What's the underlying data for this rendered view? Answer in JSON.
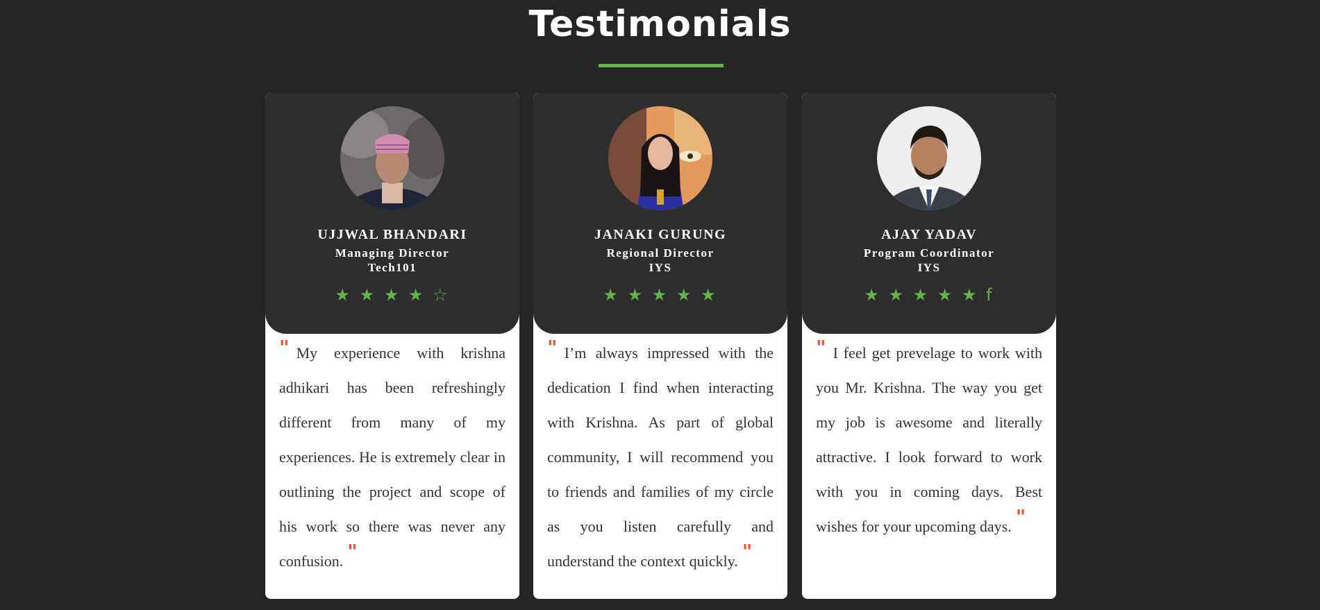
{
  "section": {
    "title": "Testimonials"
  },
  "colors": {
    "background": "#252525",
    "card_header": "#2d2d2d",
    "accent": "#62b348",
    "quote_mark": "#e8582c"
  },
  "testimonials": [
    {
      "name": "UJJWAL BHANDARI",
      "role": "Managing Director",
      "organization": "Tech101",
      "rating": 4,
      "stars": [
        "★",
        "★",
        "★",
        "★",
        "☆"
      ],
      "quote": "My experience with krishna adhikari has been refreshingly different from many of my experiences. He is extremely clear in outlining the project and scope of his work so there was never any confusion.",
      "quote_open": "\"",
      "quote_close": "\""
    },
    {
      "name": "JANAKI GURUNG",
      "role": "Regional Director",
      "organization": "IYS",
      "rating": 5,
      "stars": [
        "★",
        "★",
        "★",
        "★",
        "★"
      ],
      "quote": "I’m always impressed with the dedication I find when interacting with Krishna. As part of global community, I will recommend you to friends and families of my circle as you listen carefully and understand the context quickly.",
      "quote_open": "\"",
      "quote_close": "\""
    },
    {
      "name": "AJAY YADAV",
      "role": "Program Coordinator",
      "organization": "IYS",
      "rating": 5.5,
      "stars": [
        "★",
        "★",
        "★",
        "★",
        "★",
        "f"
      ],
      "quote": "I feel get prevelage to work with you Mr. Krishna. The way you get my job is awesome and literally attractive. I look forward to work with you in coming days. Best wishes for your upcoming days.",
      "quote_open": "\"",
      "quote_close": "\""
    }
  ]
}
